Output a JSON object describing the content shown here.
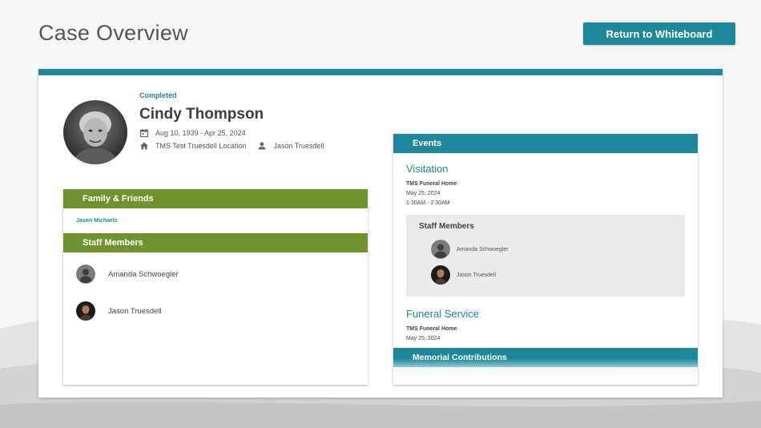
{
  "page": {
    "title": "Case Overview",
    "return_button": "Return to Whiteboard"
  },
  "case": {
    "status": "Completed",
    "name": "Cindy Thompson",
    "dates": "Aug 10, 1939 - Apr 25, 2024",
    "location": "TMS Test Truesdell Location",
    "director": "Jason Truesdell"
  },
  "family_friends": {
    "title": "Family & Friends",
    "items": [
      "Jason Michaels"
    ]
  },
  "staff": {
    "title": "Staff Members",
    "members": [
      "Amanda Schwoegler",
      "Jason Truesdell"
    ]
  },
  "events": {
    "title": "Events",
    "list": [
      {
        "name": "Visitation",
        "location": "TMS Funeral Home",
        "date": "May 25, 2024",
        "time": "1:30AM - 2:30AM",
        "staff_title": "Staff Members",
        "staff": [
          "Amanda Schwoegler",
          "Jason Truesdell"
        ]
      },
      {
        "name": "Funeral Service",
        "location": "TMS Funeral Home",
        "date": "May 25, 2024"
      }
    ],
    "memorial_title": "Memorial Contributions"
  },
  "colors": {
    "teal": "#1f879a",
    "green": "#6f942f"
  },
  "icons": [
    "calendar-icon",
    "home-icon",
    "person-icon"
  ]
}
